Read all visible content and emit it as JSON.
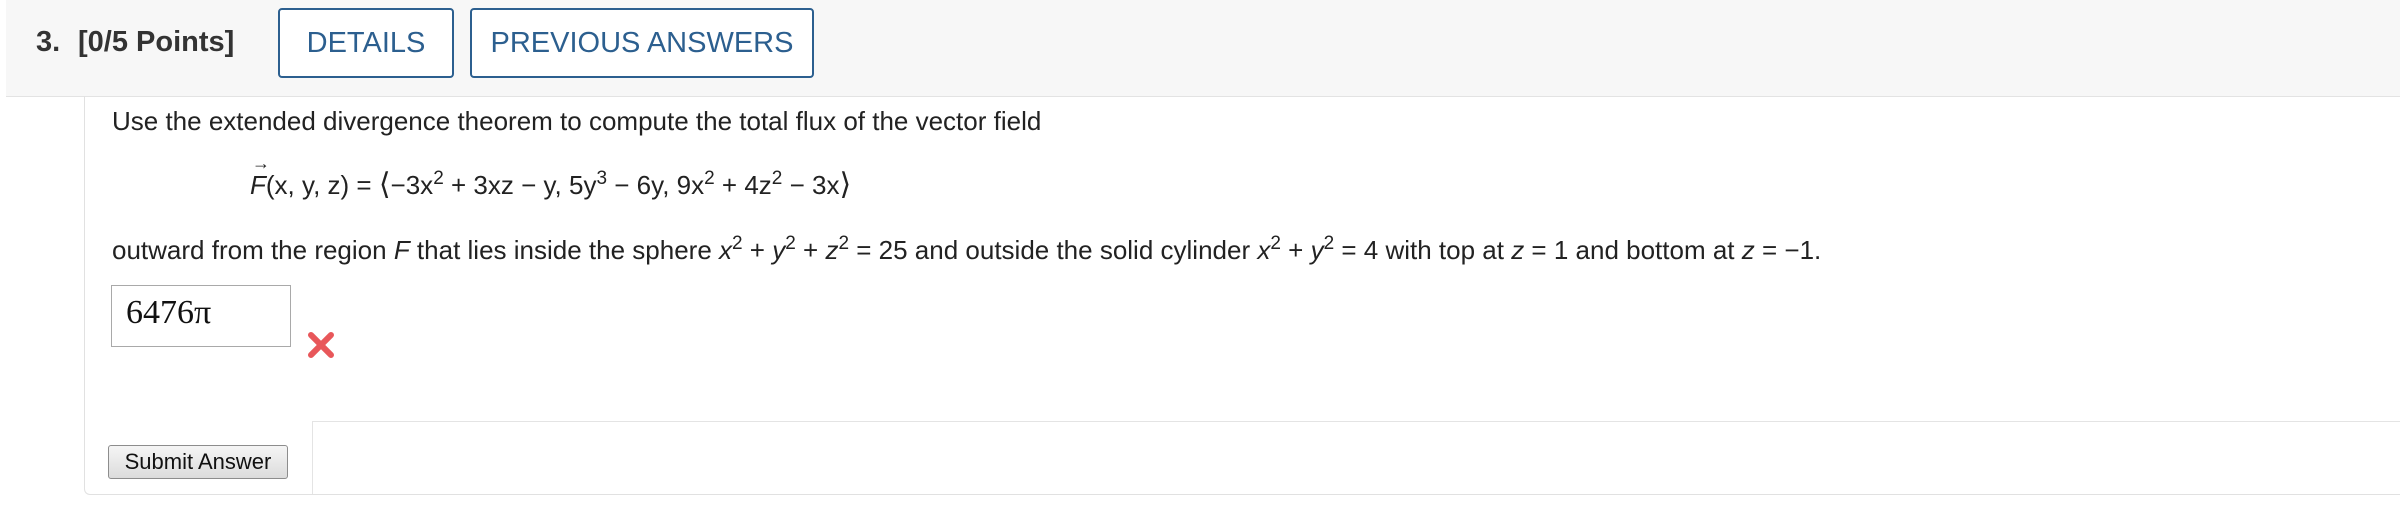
{
  "header": {
    "question_number": "3.",
    "points": "[0/5 Points]",
    "details_label": "DETAILS",
    "previous_answers_label": "PREVIOUS ANSWERS"
  },
  "question": {
    "intro": "Use the extended divergence theorem to compute the total flux of the vector field",
    "field_name": "F",
    "field_args": "(x, y, z) = ",
    "component_1": "−3x",
    "component_1_exp": "2",
    "component_1_rest": " + 3xz − y, 5y",
    "component_2_exp": "3",
    "component_2_rest": " − 6y, 9x",
    "component_3_exp": "2",
    "component_3_mid": " + 4z",
    "component_3_exp2": "2",
    "component_3_rest": " − 3x",
    "region_a": "outward from the region ",
    "region_var": "F",
    "region_b": " that lies inside the sphere ",
    "sphere_x": "x",
    "sphere_y": "y",
    "sphere_z": "z",
    "exp2": "2",
    "plus": " + ",
    "sphere_eq": " = 25 and outside the solid cylinder ",
    "cyl_eq": " = 4 with top at ",
    "top_eq": " = 1 and bottom at ",
    "bottom_eq": " = −1."
  },
  "answer": {
    "value": "6476π",
    "status": "incorrect",
    "icon": "wrong-x-icon",
    "icon_color": "#e8575a"
  },
  "submit": {
    "label": "Submit Answer"
  },
  "colors": {
    "accent": "#2c5f8f"
  }
}
